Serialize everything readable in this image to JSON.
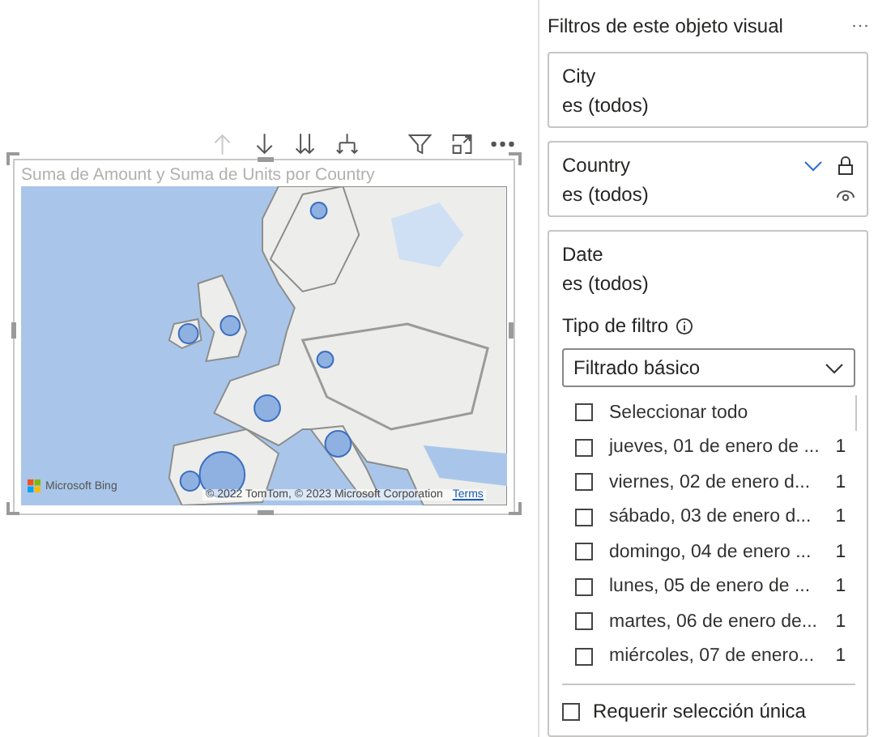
{
  "visual": {
    "title": "Suma de Amount y Suma de Units por Country",
    "logo": "Microsoft Bing",
    "attribution": "© 2022 TomTom, © 2023 Microsoft Corporation",
    "terms": "Terms"
  },
  "filter_pane": {
    "title": "Filtros de este objeto visual",
    "cards": [
      {
        "field": "City",
        "summary": "es (todos)",
        "expanded": false,
        "hovered": false
      },
      {
        "field": "Country",
        "summary": "es (todos)",
        "expanded": false,
        "hovered": true
      },
      {
        "field": "Date",
        "summary": "es (todos)",
        "expanded": true,
        "hovered": false,
        "filter_type_label": "Tipo de filtro",
        "filter_type": "Filtrado básico",
        "select_all": {
          "label": "Seleccionar todo",
          "checked": false
        },
        "items": [
          {
            "label": "jueves, 01 de enero de ...",
            "count": "1",
            "checked": false
          },
          {
            "label": "viernes, 02 de enero d...",
            "count": "1",
            "checked": false
          },
          {
            "label": "sábado, 03 de enero d...",
            "count": "1",
            "checked": false
          },
          {
            "label": "domingo, 04 de enero ...",
            "count": "1",
            "checked": false
          },
          {
            "label": "lunes, 05 de enero de ...",
            "count": "1",
            "checked": false
          },
          {
            "label": "martes, 06 de enero de...",
            "count": "1",
            "checked": false
          },
          {
            "label": "miércoles, 07 de enero...",
            "count": "1",
            "checked": false
          }
        ],
        "require_single": {
          "label": "Requerir selección única",
          "checked": false
        }
      }
    ]
  }
}
